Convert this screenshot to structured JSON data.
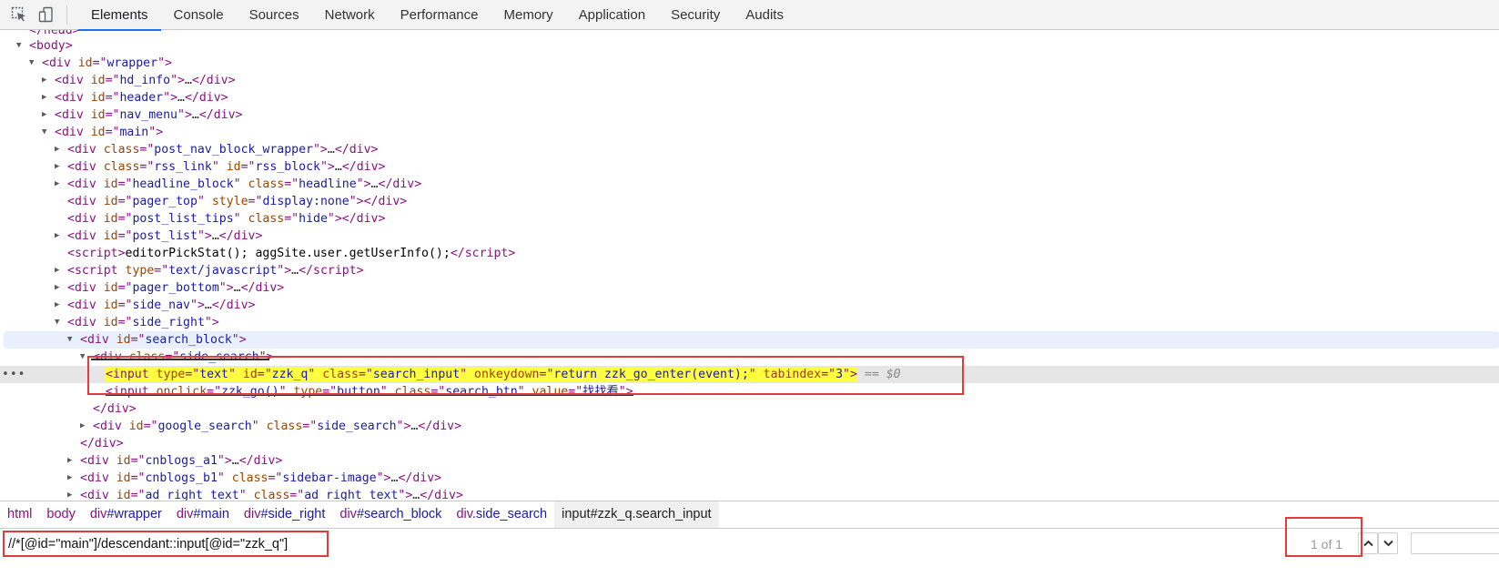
{
  "tabs": [
    {
      "label": "Elements",
      "active": true
    },
    {
      "label": "Console"
    },
    {
      "label": "Sources"
    },
    {
      "label": "Network"
    },
    {
      "label": "Performance"
    },
    {
      "label": "Memory"
    },
    {
      "label": "Application"
    },
    {
      "label": "Security"
    },
    {
      "label": "Audits"
    }
  ],
  "icons": {
    "inspect": "inspect-element-icon",
    "device": "device-toolbar-icon"
  },
  "colors": {
    "tab_underline": "#1a73e8",
    "tag": "#881280",
    "attr_name": "#994500",
    "attr_value": "#1a1aa6",
    "highlight": "#ffff3f",
    "annotation": "#e33b3b"
  },
  "tree": {
    "head_close": "</head>",
    "body_open": "<body>",
    "wrapper": {
      "id": "wrapper"
    },
    "hd_info": {
      "id": "hd_info"
    },
    "header": {
      "id": "header"
    },
    "nav_menu": {
      "id": "nav_menu"
    },
    "main": {
      "id": "main"
    },
    "post_nav": {
      "cls": "post_nav_block_wrapper"
    },
    "rss": {
      "cls": "rss_link",
      "id": "rss_block"
    },
    "headline": {
      "id": "headline_block",
      "cls": "headline"
    },
    "pager_top": {
      "id": "pager_top",
      "style": "display:none"
    },
    "post_list_tips": {
      "id": "post_list_tips",
      "cls": "hide"
    },
    "post_list": {
      "id": "post_list"
    },
    "script_inline": {
      "text": "editorPickStat(); aggSite.user.getUserInfo();"
    },
    "script_type": {
      "type": "text/javascript"
    },
    "pager_bottom": {
      "id": "pager_bottom"
    },
    "side_nav": {
      "id": "side_nav"
    },
    "side_right": {
      "id": "side_right"
    },
    "search_block": {
      "id": "search_block"
    },
    "side_search": {
      "cls": "side_search"
    },
    "input_selected": {
      "type": "text",
      "id": "zzk_q",
      "cls": "search_input",
      "onkeydown": "return zzk_go_enter(event);",
      "tabindex": "3",
      "marker": "== $0"
    },
    "input_button": {
      "onclick": "zzk_go()",
      "type": "button",
      "cls": "search_btn",
      "value": "找找看"
    },
    "google_search": {
      "id": "google_search",
      "cls": "side_search"
    },
    "cnblogs_a1": {
      "id": "cnblogs_a1"
    },
    "cnblogs_b1": {
      "id": "cnblogs_b1",
      "cls": "sidebar-image"
    },
    "ad_right_text": {
      "id": "ad_right_text",
      "cls": "ad_right_text"
    }
  },
  "breadcrumbs": [
    {
      "el": "html",
      "cls": ""
    },
    {
      "el": "body",
      "cls": ""
    },
    {
      "el": "div",
      "cls": "#wrapper"
    },
    {
      "el": "div",
      "cls": "#main"
    },
    {
      "el": "div",
      "cls": "#side_right"
    },
    {
      "el": "div",
      "cls": "#search_block"
    },
    {
      "el": "div",
      "cls": ".side_search"
    },
    {
      "el": "input",
      "cls": "#zzk_q.search_input",
      "current": true
    }
  ],
  "search": {
    "value": "//*[@id=\"main\"]/descendant::input[@id=\"zzk_q\"]",
    "match_count": "1 of 1"
  }
}
